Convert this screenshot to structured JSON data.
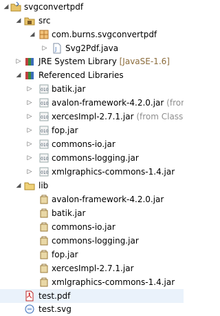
{
  "tree": {
    "project": "svgconvertpdf",
    "src": "src",
    "package": "com.burns.svgconvertpdf",
    "java_file": "Svg2Pdf.java",
    "jre_label": "JRE System Library",
    "jre_version": "[JavaSE-1.6]",
    "referenced_libraries": "Referenced Libraries",
    "ref_jars": [
      {
        "name": "batik.jar",
        "suffix": ""
      },
      {
        "name": "avalon-framework-4.2.0.jar",
        "suffix": " (from"
      },
      {
        "name": "xercesImpl-2.7.1.jar",
        "suffix": " (from Class-P"
      },
      {
        "name": "fop.jar",
        "suffix": ""
      },
      {
        "name": "commons-io.jar",
        "suffix": ""
      },
      {
        "name": "commons-logging.jar",
        "suffix": ""
      },
      {
        "name": "xmlgraphics-commons-1.4.jar",
        "suffix": ""
      }
    ],
    "lib_folder": "lib",
    "lib_jars": [
      "avalon-framework-4.2.0.jar",
      "batik.jar",
      "commons-io.jar",
      "commons-logging.jar",
      "fop.jar",
      "xercesImpl-2.7.1.jar",
      "xmlgraphics-commons-1.4.jar"
    ],
    "pdf_file": "test.pdf",
    "svg_file": "test.svg"
  },
  "icons": {
    "project": "project-folder-icon",
    "src": "source-folder-icon",
    "package": "package-icon",
    "java": "java-file-icon",
    "library": "library-container-icon",
    "jar": "jar-file-icon",
    "folder": "folder-icon",
    "pdf": "pdf-file-icon",
    "svg": "svg-file-icon"
  }
}
